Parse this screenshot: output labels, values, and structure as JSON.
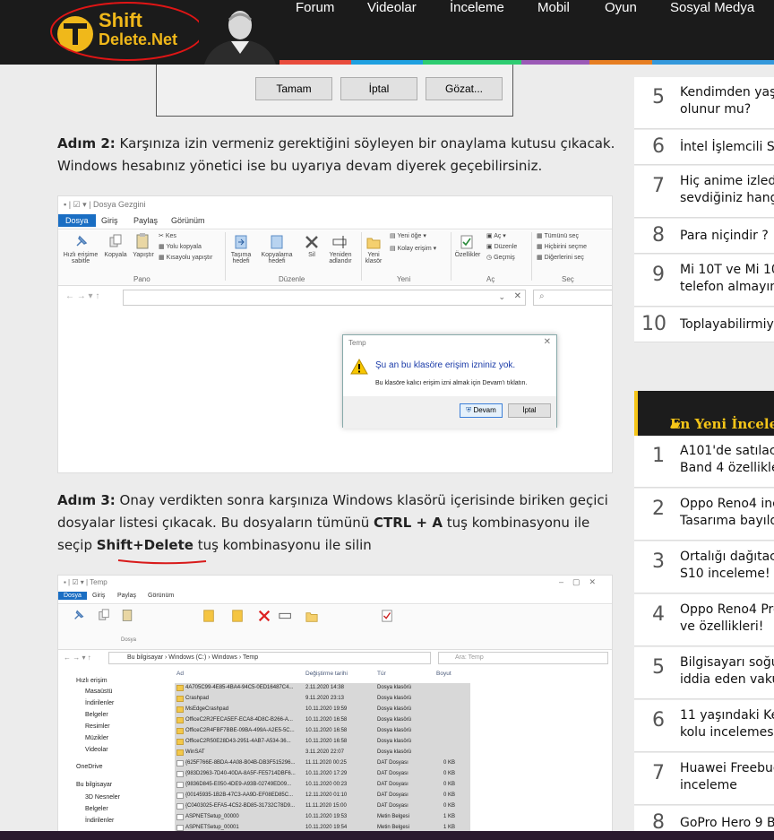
{
  "header": {
    "logo_line1": "Shift",
    "logo_line2": "Delete.Net",
    "nav": [
      "Forum",
      "Videolar",
      "İnceleme",
      "Mobil",
      "Oyun",
      "Sosyal Medya"
    ],
    "stripe_colors": [
      "#e84c3d",
      "#1fa0e0",
      "#2ecc71",
      "#f39c12",
      "#9b59b6",
      "#e67e22",
      "#3498db",
      "#27ae60"
    ]
  },
  "top_dialog": {
    "buttons": [
      "Tamam",
      "İptal",
      "Gözat..."
    ]
  },
  "article": {
    "step2_label": "Adım 2:",
    "step2_text": " Karşınıza izin vermeniz gerektiğini söyleyen bir onaylama kutusu çıkacak. Windows hesabınız yönetici ise bu uyarıya devam diyerek geçebilirsiniz.",
    "step3_label": "Adım 3:",
    "step3_text_a": " Onay verdikten sonra karşınıza Windows klasörü içerisinde biriken geçici dosyalar listesi çıkacak. Bu dosyaların tümünü ",
    "step3_key1": "CTRL + A",
    "step3_text_b": " tuş kombinasyonu ile seçip ",
    "step3_key2": "Shift+Delete",
    "step3_text_c": " tuş kombinasyonu ile silin"
  },
  "screenshot1": {
    "title": "Dosya Gezgini",
    "tabs": [
      "Dosya",
      "Giriş",
      "Paylaş",
      "Görünüm"
    ],
    "groups": [
      "Pano",
      "Düzenle",
      "Yeni",
      "Aç",
      "Seç"
    ],
    "ribbon_labels": [
      "Hızlı erişime sabitle",
      "Kopyala",
      "Yapıştır",
      "Kes",
      "Yolu kopyala",
      "Kısayolu yapıştır",
      "Taşıma hedefi",
      "Kopyalama hedefi",
      "Sil",
      "Yeniden adlandır",
      "Yeni klasör",
      "Yeni öğe",
      "Kolay erişim",
      "Özellikler",
      "Aç",
      "Düzenle",
      "Geçmiş",
      "Tümünü seç",
      "Hiçbirini seçme",
      "Diğerlerini seç"
    ],
    "dialog": {
      "title": "Temp",
      "heading": "Şu an bu klasöre erişim izniniz yok.",
      "body": "Bu klasöre kalıcı erişim izni almak için Devam'ı tıklatın.",
      "btn_continue": "Devam",
      "btn_cancel": "İptal"
    }
  },
  "screenshot2": {
    "title": "Temp",
    "tabs": [
      "Dosya",
      "Giriş",
      "Paylaş",
      "Görünüm"
    ],
    "breadcrumb": "Bu bilgisayar › Windows (C:) › Windows › Temp",
    "search_placeholder": "Ara: Temp",
    "columns": [
      "Ad",
      "Değiştirme tarihi",
      "Tür",
      "Boyut"
    ],
    "nav_items": [
      "Hızlı erişim",
      "Masaüstü",
      "İndirilenler",
      "Belgeler",
      "Resimler",
      "Müzikler",
      "Videolar",
      "OneDrive",
      "Bu bilgisayar",
      "3D Nesneler",
      "Belgeler",
      "İndirilenler"
    ],
    "rows": [
      [
        "4A705C99-4E85-4BA4-94C5-0ED16487C4...",
        "2.11.2020 14:38",
        "Dosya klasörü",
        ""
      ],
      [
        "Crashpad",
        "9.11.2020 23:13",
        "Dosya klasörü",
        ""
      ],
      [
        "MsEdgeCrashpad",
        "10.11.2020 19:59",
        "Dosya klasörü",
        ""
      ],
      [
        "OfficeC2R2FECA5EF-ECA8-4D8C-B266-A...",
        "10.11.2020 16:58",
        "Dosya klasörü",
        ""
      ],
      [
        "OfficeC2R4FBF7BBE-09BA-499A-A2E5-5C...",
        "10.11.2020 16:58",
        "Dosya klasörü",
        ""
      ],
      [
        "OfficeC2R50E28D43-2951-4AB7-A534-36...",
        "10.11.2020 16:58",
        "Dosya klasörü",
        ""
      ],
      [
        "WinSAT",
        "3.11.2020 22:07",
        "Dosya klasörü",
        ""
      ],
      [
        "{625F766E-8BDA-4A08-B04B-DB3F515296...",
        "11.11.2020 00:25",
        "DAT Dosyası",
        "0 KB"
      ],
      [
        "{983D2963-7D40-40DA-8A5F-FE5714DBF6...",
        "10.11.2020 17:29",
        "DAT Dosyası",
        "0 KB"
      ],
      [
        "{9836D845-E050-4DE9-A93B-02749ED09...",
        "10.11.2020 00:23",
        "DAT Dosyası",
        "0 KB"
      ],
      [
        "{00145935-1B2B-47C3-AA9D-EF08ED85C...",
        "12.11.2020 01:10",
        "DAT Dosyası",
        "0 KB"
      ],
      [
        "{C0403025-EFA5-4C52-BD85-31732C78D9...",
        "11.11.2020 15:00",
        "DAT Dosyası",
        "0 KB"
      ],
      [
        "ASPNETSetup_00000",
        "10.11.2020 19:53",
        "Metin Belgesi",
        "1 KB"
      ],
      [
        "ASPNETSetup_00001",
        "10.11.2020 19:54",
        "Metin Belgesi",
        "1 KB"
      ]
    ]
  },
  "sidebar_top": [
    {
      "n": "5",
      "t": "Kendimden yaşç",
      "t2": "olunur mu?"
    },
    {
      "n": "6",
      "t": "İntel İşlemcili S",
      "t2": ""
    },
    {
      "n": "7",
      "t": "Hiç anime izled",
      "t2": "sevdiğiniz hang"
    },
    {
      "n": "8",
      "t": "Para niçindir ?",
      "t2": ""
    },
    {
      "n": "9",
      "t": "Mi 10T ve Mi 10",
      "t2": "telefon almayın"
    },
    {
      "n": "10",
      "t": "Toplayabilirmiy",
      "t2": ""
    }
  ],
  "section_title": "En Yeni İncelem",
  "sidebar_bottom": [
    {
      "n": "1",
      "t": "A101'de satılac",
      "t2": "Band 4 özellikle"
    },
    {
      "n": "2",
      "t": "Oppo Reno4 inc",
      "t2": "Tasarıma bayıld"
    },
    {
      "n": "3",
      "t": "Ortalığı dağıtac",
      "t2": "S10 inceleme! ("
    },
    {
      "n": "4",
      "t": "Oppo Reno4 Pro",
      "t2": "ve özellikleri!"
    },
    {
      "n": "5",
      "t": "Bilgisayarı soğu",
      "t2": "iddia eden vaku"
    },
    {
      "n": "6",
      "t": "11 yaşındaki Ke",
      "t2": "kolu incelemesi"
    },
    {
      "n": "7",
      "t": "Huawei Freebuc",
      "t2": "inceleme"
    },
    {
      "n": "8",
      "t": "GoPro Hero 9 B",
      "t2": ""
    }
  ]
}
